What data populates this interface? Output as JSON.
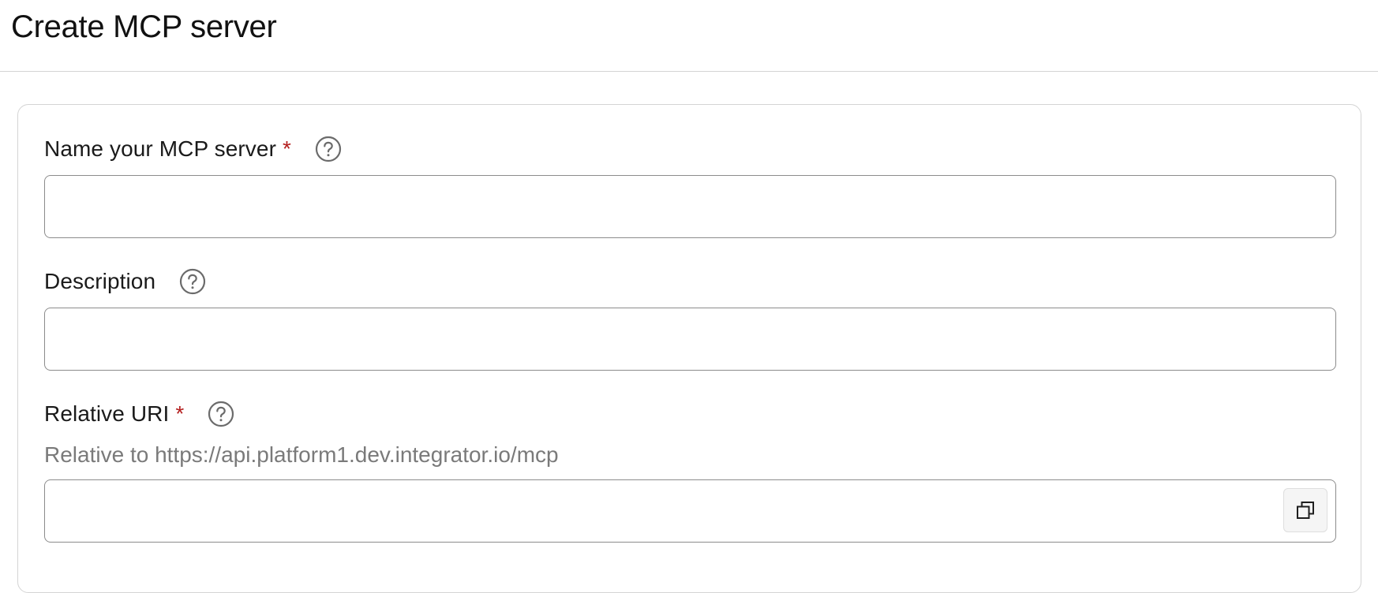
{
  "page": {
    "title": "Create MCP server"
  },
  "form": {
    "name_field": {
      "label": "Name your MCP server",
      "required_mark": "*",
      "value": "",
      "help_icon": "question-circle-icon"
    },
    "description_field": {
      "label": "Description",
      "value": "",
      "help_icon": "question-circle-icon"
    },
    "uri_field": {
      "label": "Relative URI",
      "required_mark": "*",
      "helper": "Relative to https://api.platform1.dev.integrator.io/mcp",
      "value": "",
      "help_icon": "question-circle-icon",
      "action_icon": "copy-icon"
    }
  },
  "colors": {
    "required": "#b41f1f",
    "border": "#8c8c8c",
    "divider": "#d4d4d4",
    "helper_text": "#7a7a7a",
    "icon": "#6b6b6b"
  }
}
